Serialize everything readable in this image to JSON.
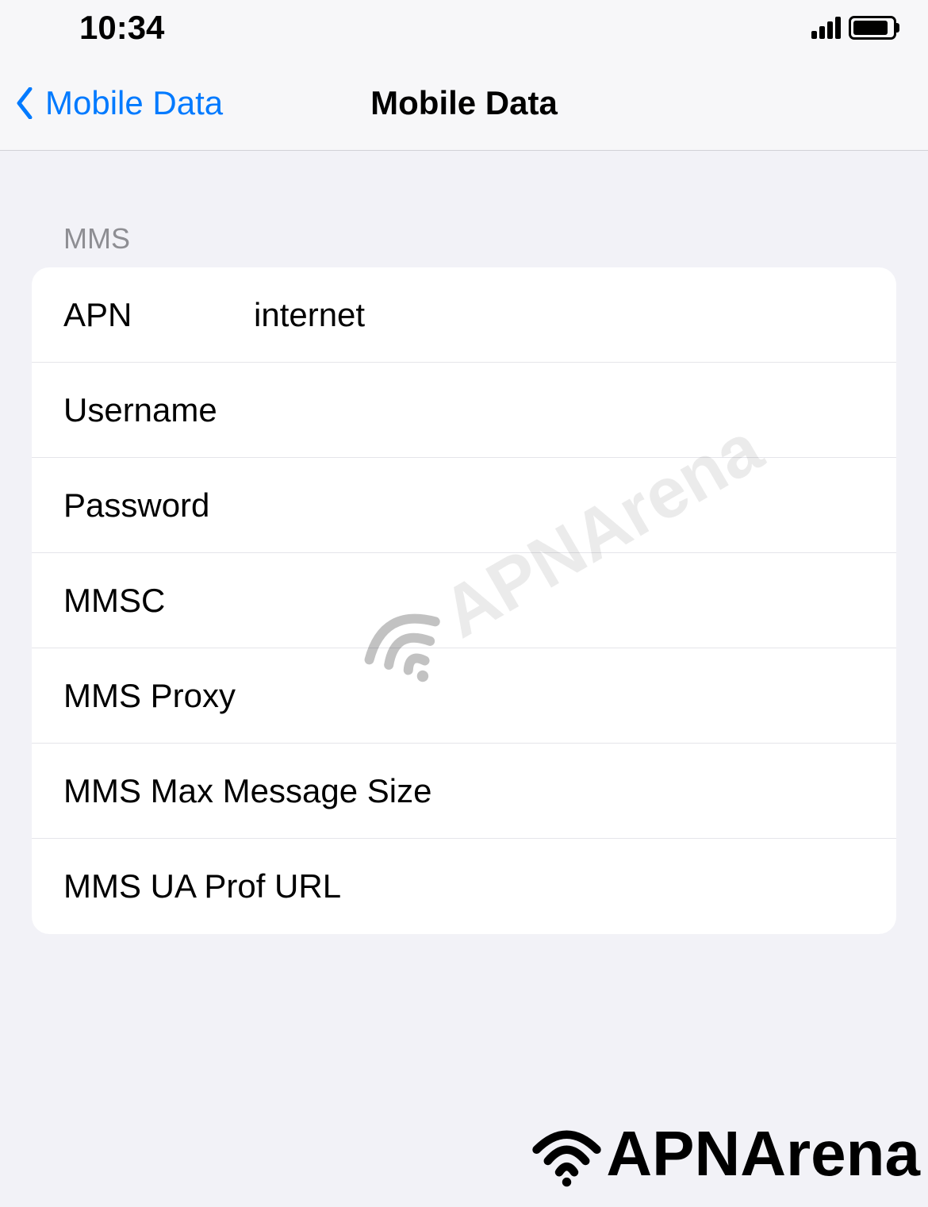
{
  "status_bar": {
    "time": "10:34"
  },
  "nav": {
    "back_label": "Mobile Data",
    "title": "Mobile Data"
  },
  "section_header": "MMS",
  "fields": {
    "apn": {
      "label": "APN",
      "value": "internet"
    },
    "username": {
      "label": "Username",
      "value": ""
    },
    "password": {
      "label": "Password",
      "value": ""
    },
    "mmsc": {
      "label": "MMSC",
      "value": ""
    },
    "mms_proxy": {
      "label": "MMS Proxy",
      "value": ""
    },
    "mms_max_message_size": {
      "label": "MMS Max Message Size",
      "value": ""
    },
    "mms_ua_prof_url": {
      "label": "MMS UA Prof URL",
      "value": ""
    }
  },
  "watermark": "APNArena",
  "logo": "APNArena"
}
